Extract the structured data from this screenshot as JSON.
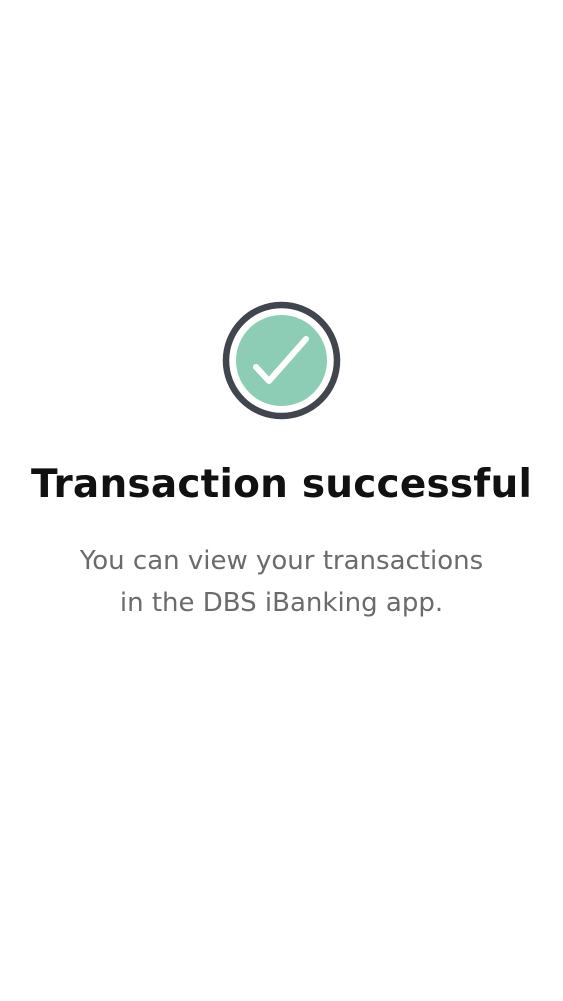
{
  "status": {
    "icon": "check-circle-icon",
    "colors": {
      "ring": "#40454e",
      "fill": "#8dcdb6",
      "check": "#ffffff"
    },
    "title": "Transaction successful",
    "message_lines": [
      "You can view your transactions",
      "in the DBS iBanking app."
    ]
  }
}
